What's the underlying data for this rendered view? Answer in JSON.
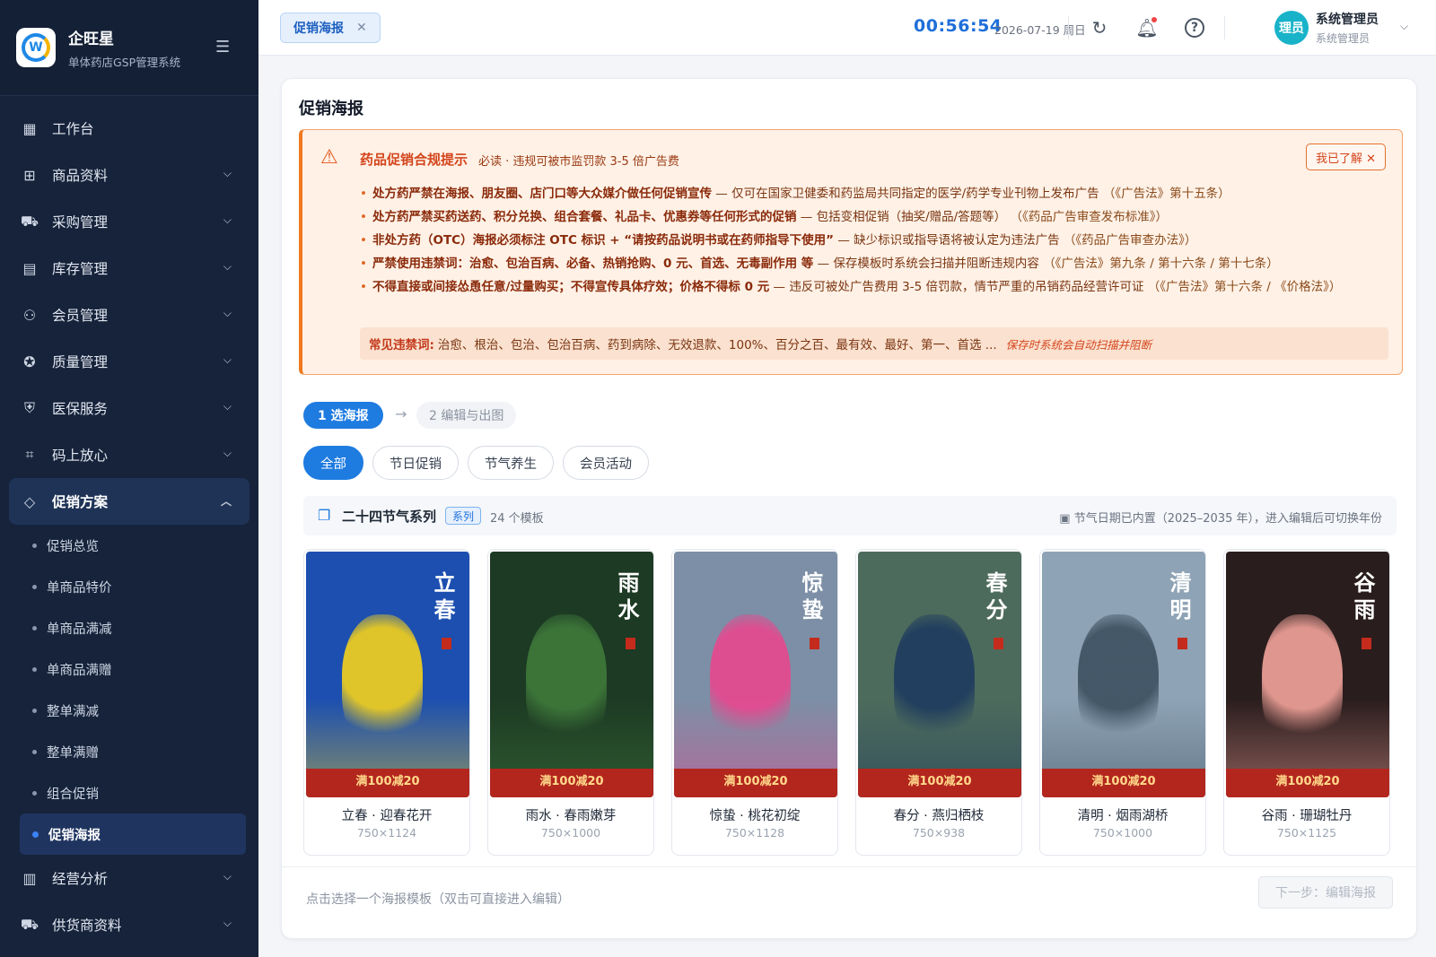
{
  "brand": {
    "name": "企旺星",
    "subtitle": "单体药店GSP管理系统",
    "logo_letter": "W"
  },
  "sidebar": {
    "items": [
      {
        "label": "工作台",
        "icon": "dashboard-icon"
      },
      {
        "label": "商品资料",
        "icon": "box-icon"
      },
      {
        "label": "采购管理",
        "icon": "cart-icon"
      },
      {
        "label": "库存管理",
        "icon": "archive-icon"
      },
      {
        "label": "会员管理",
        "icon": "users-icon"
      },
      {
        "label": "质量管理",
        "icon": "badge-check-icon"
      },
      {
        "label": "医保服务",
        "icon": "shield-icon"
      },
      {
        "label": "码上放心",
        "icon": "qrcode-icon"
      },
      {
        "label": "促销方案",
        "icon": "tag-icon"
      }
    ],
    "sub_items": [
      "促销总览",
      "单商品特价",
      "单商品满减",
      "单商品满赠",
      "整单满减",
      "整单满赠",
      "组合促销",
      "促销海报"
    ],
    "bottom_items": [
      {
        "label": "经营分析",
        "icon": "chart-icon"
      },
      {
        "label": "供货商资料",
        "icon": "truck-icon"
      }
    ]
  },
  "header": {
    "tab_label": "促销海报",
    "clock": "00:56:54",
    "date": "2026-07-19 周日",
    "avatar_text": "理员",
    "user_name": "系统管理员",
    "user_role": "系统管理员"
  },
  "page": {
    "title": "促销海报"
  },
  "warning": {
    "title": "药品促销合规提示",
    "subtitle": "必读 · 违规可被市监罚款 3-5 倍广告费",
    "dismiss_label": "我已了解 ✕",
    "rules": [
      {
        "bold": "处方药严禁在海报、朋友圈、店门口等大众媒介做任何促销宣传",
        "text": " — 仅可在国家卫健委和药监局共同指定的医学/药学专业刊物上发布广告",
        "law": "（《广告法》第十五条）"
      },
      {
        "bold": "处方药严禁买药送药、积分兑换、组合套餐、礼品卡、优惠券等任何形式的促销",
        "text": " — 包括变相促销（抽奖/赠品/答题等）",
        "law": "（《药品广告审查发布标准》）"
      },
      {
        "bold": "非处方药（OTC）海报必须标注 OTC 标识 + “请按药品说明书或在药师指导下使用”",
        "text": " — 缺少标识或指导语将被认定为违法广告",
        "law": "（《药品广告审查办法》）"
      },
      {
        "bold": "严禁使用违禁词：治愈、包治百病、必备、热销抢购、0 元、首选、无毒副作用 等",
        "text": " — 保存模板时系统会扫描并阻断违规内容",
        "law": "（《广告法》第九条 / 第十六条 / 第十七条）"
      },
      {
        "bold": "不得直接或间接怂恿任意/过量购买；不得宣传具体疗效；价格不得标 0 元",
        "text": " — 违反可被处广告费用 3-5 倍罚款，情节严重的吊销药品经营许可证",
        "law": "（《广告法》第十六条 / 《价格法》）"
      }
    ],
    "banned_label": "常见违禁词:",
    "banned_words": "治愈、根治、包治、包治百病、药到病除、无效退款、100%、百分之百、最有效、最好、第一、首选 ...",
    "banned_note": "保存时系统会自动扫描并阻断"
  },
  "steps": {
    "step1": "1 选海报",
    "arrow": "→",
    "step2": "2 编辑与出图"
  },
  "filters": [
    "全部",
    "节日促销",
    "节气养生",
    "会员活动"
  ],
  "series": {
    "title": "二十四节气系列",
    "badge": "系列",
    "count": "24 个模板",
    "note": "节气日期已内置（2025–2035 年），进入编辑后可切换年份"
  },
  "posters": [
    {
      "name": "立春 · 迎春花开",
      "size": "750×1124",
      "chars": "立春",
      "promo": "满100减20",
      "bg": "#1c4fb0",
      "accent": "#f5d21b"
    },
    {
      "name": "雨水 · 春雨嫩芽",
      "size": "750×1000",
      "chars": "雨水",
      "promo": "满100减20",
      "bg": "#1d3a24",
      "accent": "#3f7a3a"
    },
    {
      "name": "惊蛰 · 桃花初绽",
      "size": "750×1128",
      "chars": "惊蛰",
      "promo": "满100减20",
      "bg": "#7c8fa6",
      "accent": "#e8478e"
    },
    {
      "name": "春分 · 燕归栖枝",
      "size": "750×938",
      "chars": "春分",
      "promo": "满100减20",
      "bg": "#4d6b5c",
      "accent": "#1e3a5f"
    },
    {
      "name": "清明 · 烟雨湖桥",
      "size": "750×1000",
      "chars": "清明",
      "promo": "满100减20",
      "bg": "#8ea3b5",
      "accent": "#3b4f5f"
    },
    {
      "name": "谷雨 · 珊瑚牡丹",
      "size": "750×1125",
      "chars": "谷雨",
      "promo": "满100减20",
      "bg": "#2a1d1d",
      "accent": "#f2a39a"
    }
  ],
  "footer": {
    "hint": "点击选择一个海报模板（双击可直接进入编辑）",
    "next_label": "下一步：编辑海报"
  }
}
